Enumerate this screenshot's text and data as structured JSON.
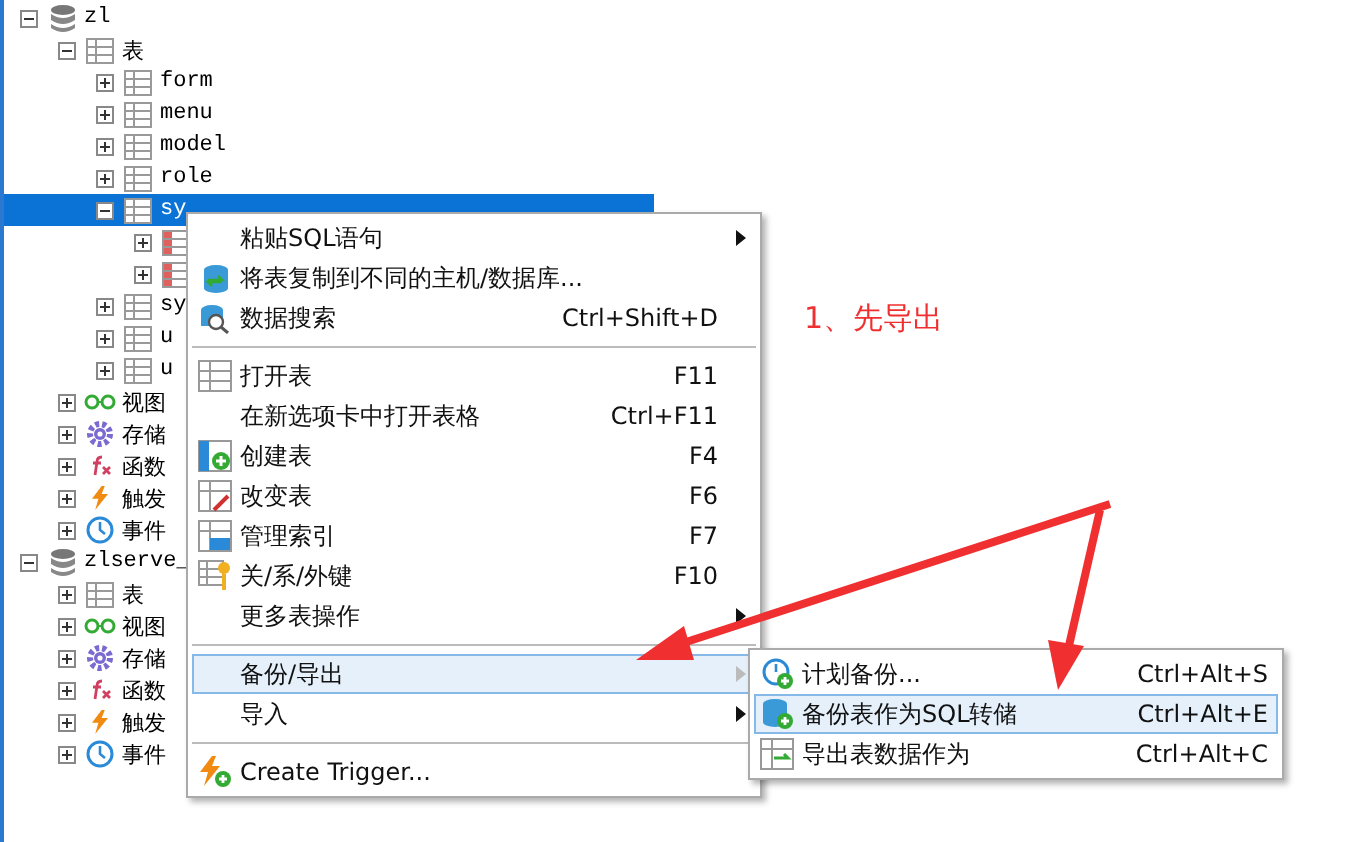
{
  "tree": [
    {
      "label": "zl",
      "kind": "db",
      "expanded": true,
      "selected": false,
      "children": [
        {
          "label": "表",
          "kind": "table",
          "expanded": true,
          "selected": false,
          "children": [
            {
              "label": "form",
              "kind": "table",
              "expanded": false,
              "selected": false
            },
            {
              "label": "menu",
              "kind": "table",
              "expanded": false,
              "selected": false
            },
            {
              "label": "model",
              "kind": "table",
              "expanded": false,
              "selected": false
            },
            {
              "label": "role",
              "kind": "table",
              "expanded": false,
              "selected": false
            },
            {
              "label": "sy",
              "kind": "table",
              "expanded": true,
              "selected": true,
              "children": [
                {
                  "kind": "field",
                  "expanded": false,
                  "selected": false
                },
                {
                  "kind": "field",
                  "expanded": false,
                  "selected": false
                }
              ]
            },
            {
              "label": "sy",
              "kind": "table",
              "expanded": false,
              "selected": false
            },
            {
              "label": "u",
              "kind": "table",
              "expanded": false,
              "selected": false
            },
            {
              "label": "u",
              "kind": "table",
              "expanded": false,
              "selected": false
            }
          ]
        },
        {
          "label": "视图",
          "kind": "view",
          "expanded": false,
          "selected": false
        },
        {
          "label": "存储",
          "kind": "proc",
          "expanded": false,
          "selected": false
        },
        {
          "label": "函数",
          "kind": "func",
          "expanded": false,
          "selected": false
        },
        {
          "label": "触发",
          "kind": "trigger",
          "expanded": false,
          "selected": false
        },
        {
          "label": "事件",
          "kind": "event",
          "expanded": false,
          "selected": false
        }
      ]
    },
    {
      "label": "zlserve_",
      "kind": "db",
      "expanded": true,
      "selected": false,
      "children": [
        {
          "label": "表",
          "kind": "table",
          "expanded": false,
          "selected": false
        },
        {
          "label": "视图",
          "kind": "view",
          "expanded": false,
          "selected": false
        },
        {
          "label": "存储",
          "kind": "proc",
          "expanded": false,
          "selected": false
        },
        {
          "label": "函数",
          "kind": "func",
          "expanded": false,
          "selected": false
        },
        {
          "label": "触发",
          "kind": "trigger",
          "expanded": false,
          "selected": false
        },
        {
          "label": "事件",
          "kind": "event",
          "expanded": false,
          "selected": false
        }
      ]
    }
  ],
  "context_menu": [
    {
      "kind": "plain",
      "label": "粘贴SQL语句",
      "submenu": true,
      "selected": false
    },
    {
      "kind": "copy",
      "label": "将表复制到不同的主机/数据库...",
      "submenu": false,
      "selected": false
    },
    {
      "kind": "search",
      "label": "数据搜索",
      "shortcut": "Ctrl+Shift+D",
      "submenu": false,
      "selected": false
    },
    {
      "kind": "separator"
    },
    {
      "kind": "table",
      "label": "打开表",
      "shortcut": "F11",
      "submenu": false,
      "selected": false
    },
    {
      "kind": "plain",
      "label": "在新选项卡中打开表格",
      "shortcut": "Ctrl+F11",
      "submenu": false,
      "selected": false
    },
    {
      "kind": "create",
      "label": "创建表",
      "shortcut": "F4",
      "submenu": false,
      "selected": false
    },
    {
      "kind": "alter",
      "label": "改变表",
      "shortcut": "F6",
      "submenu": false,
      "selected": false
    },
    {
      "kind": "index",
      "label": "管理索引",
      "shortcut": "F7",
      "submenu": false,
      "selected": false
    },
    {
      "kind": "key",
      "label": "关/系/外键",
      "shortcut": "F10",
      "submenu": false,
      "selected": false
    },
    {
      "kind": "plain",
      "label": "更多表操作",
      "submenu": true,
      "selected": false
    },
    {
      "kind": "separator"
    },
    {
      "kind": "plain",
      "label": "备份/导出",
      "submenu": true,
      "selected": true
    },
    {
      "kind": "plain",
      "label": "导入",
      "submenu": true,
      "selected": false
    },
    {
      "kind": "separator"
    },
    {
      "kind": "trigger",
      "label": "Create Trigger...",
      "submenu": false,
      "selected": false
    }
  ],
  "submenu": [
    {
      "kind": "schedule",
      "label": "计划备份...",
      "shortcut": "Ctrl+Alt+S",
      "selected": false
    },
    {
      "kind": "dump",
      "label": "备份表作为SQL转储",
      "shortcut": "Ctrl+Alt+E",
      "selected": true
    },
    {
      "kind": "export",
      "label": "导出表数据作为",
      "shortcut": "Ctrl+Alt+C",
      "selected": false
    }
  ],
  "annotation": "1、先导出"
}
